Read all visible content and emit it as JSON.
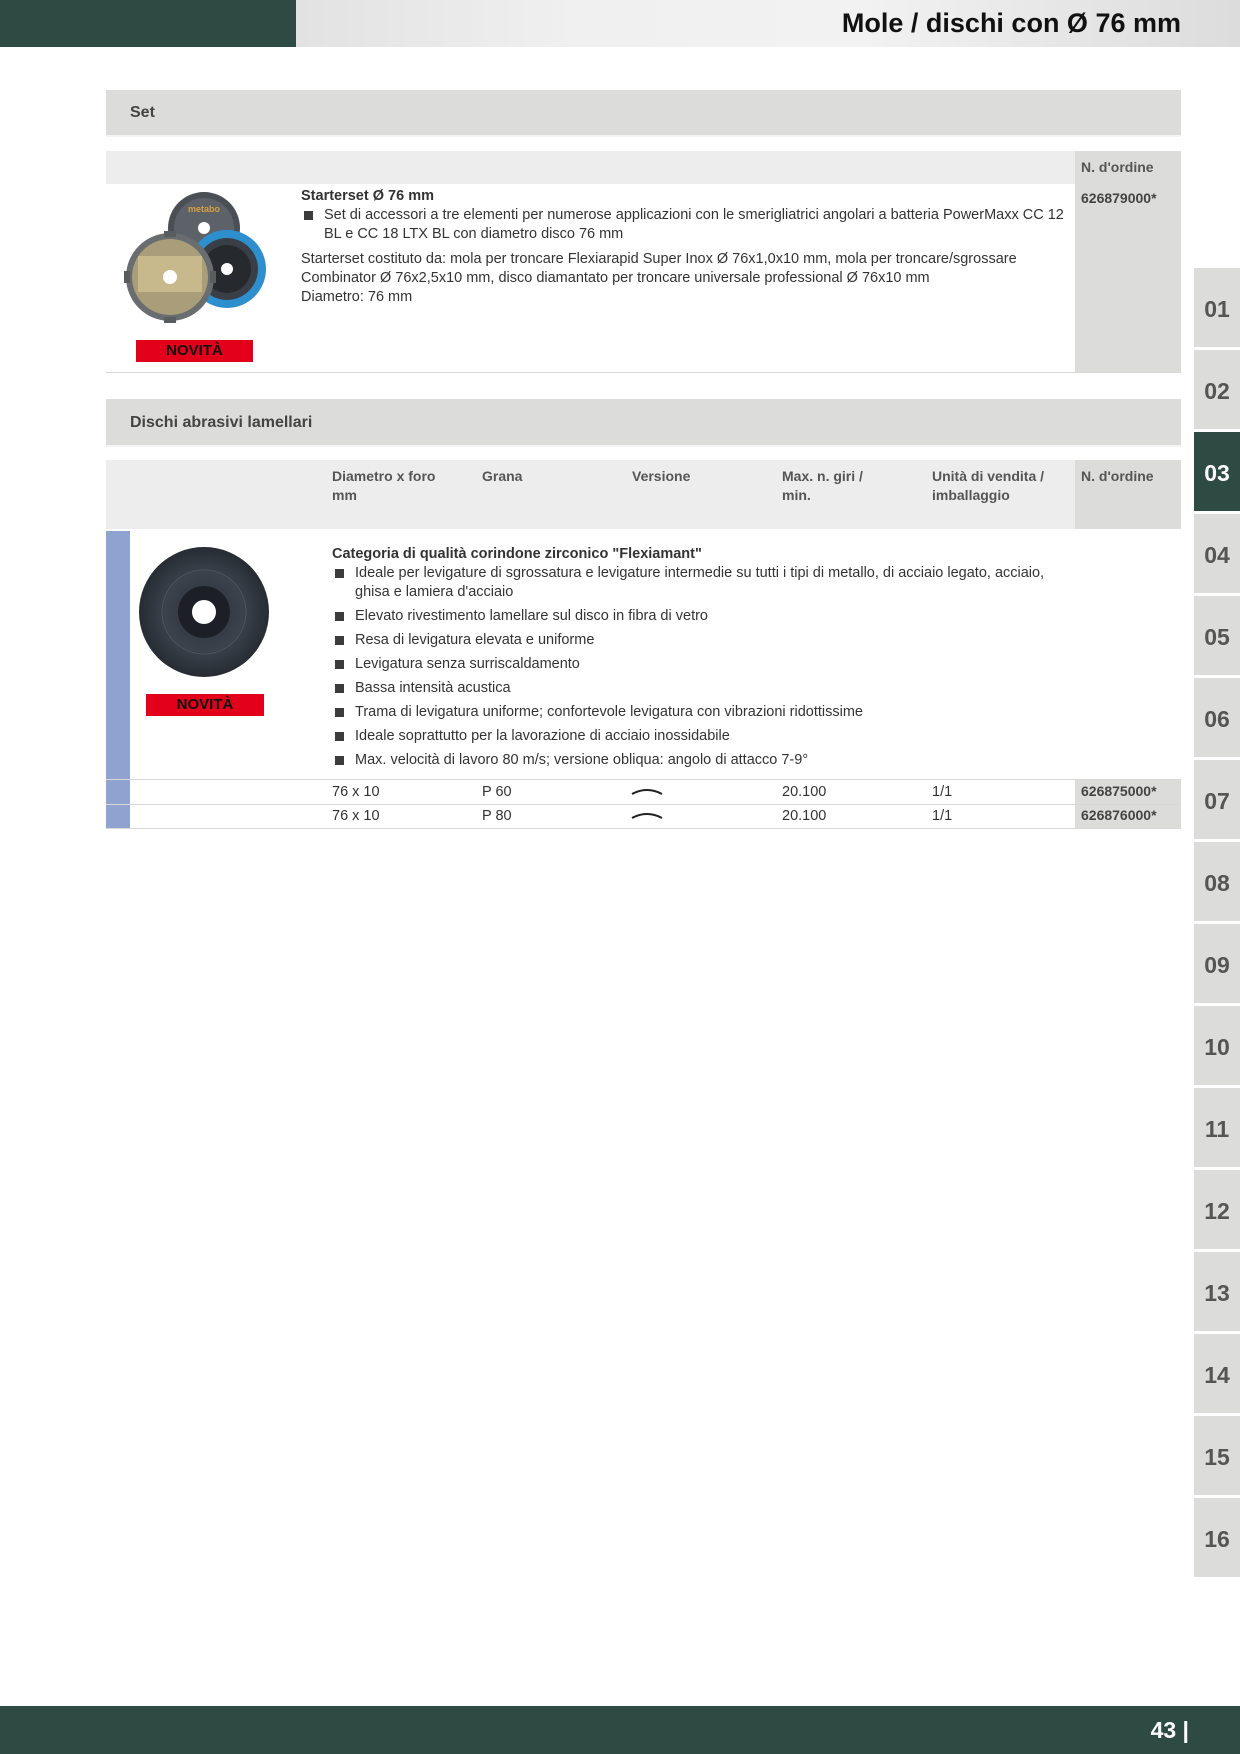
{
  "header": {
    "title": "Mole / dischi con Ø 76 mm"
  },
  "set_section": {
    "title": "Set",
    "col_order": "N. d'ordine",
    "product": {
      "name": "Starterset Ø 76 mm",
      "bullet": "Set di accessori a tre elementi per numerose applicazioni con le smerigliatrici angolari a batteria PowerMaxx CC 12 BL e CC 18 LTX BL con diametro disco 76 mm",
      "description": "Starterset costituto da: mola per troncare Flexiarapid Super Inox Ø 76x1,0x10 mm, mola per troncare/sgrossare Combinator Ø 76x2,5x10 mm, disco diamantato per troncare universale professional Ø 76x10 mm",
      "diameter": "Diametro: 76 mm",
      "badge": "NOVITÀ",
      "order_no": "626879000*",
      "image_brand": "metabo"
    }
  },
  "flap_section": {
    "title": "Dischi abrasivi lamellari",
    "columns": {
      "diameter": "Diametro x foro mm",
      "grit": "Grana",
      "version": "Versione",
      "rpm": "Max. n. giri / min.",
      "unit": "Unità di vendita / imballaggio",
      "order": "N. d'ordine"
    },
    "category": "Categoria di qualità corindone zirconico \"Flexiamant\"",
    "badge": "NOVITÀ",
    "bullets": [
      "Ideale per levigature di sgrossatura e levigature intermedie su tutti i tipi di metallo, di acciaio legato, acciaio, ghisa e lamiera d'acciaio",
      "Elevato rivestimento lamellare sul disco in fibra di vetro",
      "Resa di levigatura elevata e uniforme",
      "Levigatura senza surriscaldamento",
      "Bassa intensità acustica",
      "Trama di levigatura uniforme; confortevole levigatura con vibrazioni ridottissime",
      "Ideale soprattutto per la lavorazione di acciaio inossidabile",
      "Max. velocità di lavoro 80 m/s; versione obliqua: angolo di attacco 7-9°"
    ],
    "rows": [
      {
        "diameter": "76 x 10",
        "grit": "P 60",
        "version_icon": "curved-flap-icon",
        "rpm": "20.100",
        "unit": "1/1",
        "order": "626875000*"
      },
      {
        "diameter": "76 x 10",
        "grit": "P 80",
        "version_icon": "curved-flap-icon",
        "rpm": "20.100",
        "unit": "1/1",
        "order": "626876000*"
      }
    ]
  },
  "tabs": [
    "01",
    "02",
    "03",
    "04",
    "05",
    "06",
    "07",
    "08",
    "09",
    "10",
    "11",
    "12",
    "13",
    "14",
    "15",
    "16"
  ],
  "active_tab": "03",
  "footer": {
    "page": "43 |"
  },
  "colors": {
    "brand_green": "#2d4a43",
    "novita_red": "#e2001a",
    "accent_blue": "#8ea3d0",
    "bar_grey": "#dcdcdb"
  }
}
